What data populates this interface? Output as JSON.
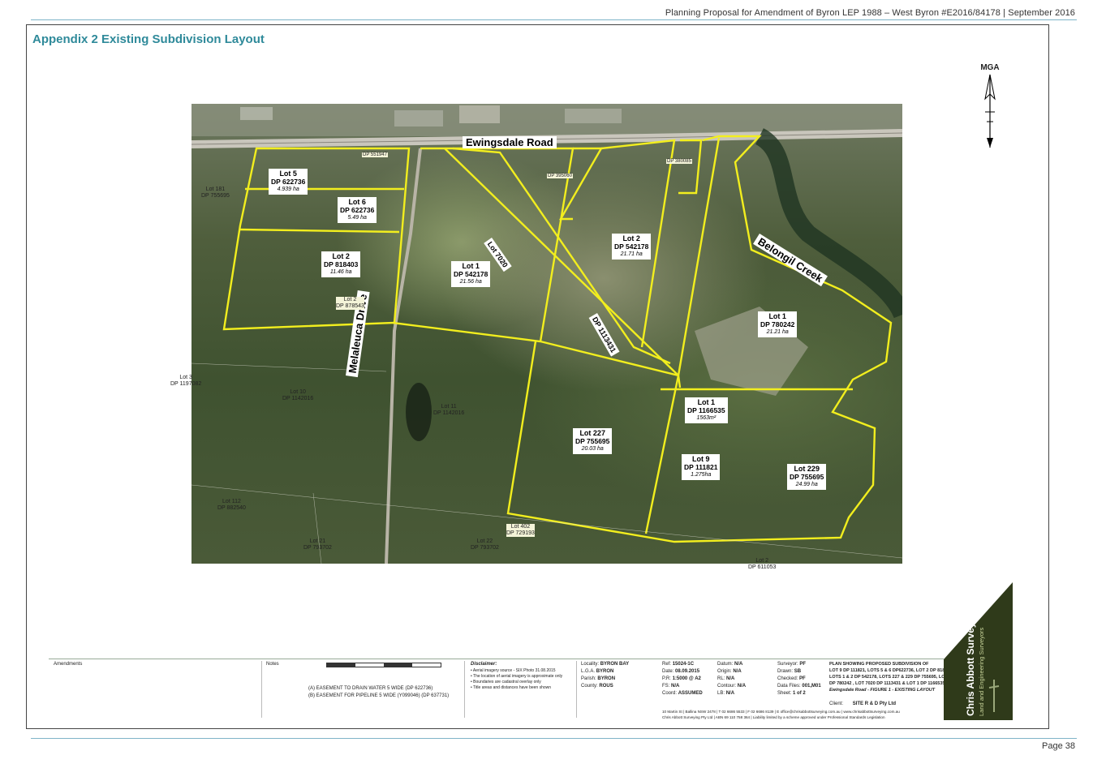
{
  "header": {
    "text": "Planning Proposal for Amendment of Byron LEP 1988 – West Byron #E2016/84178 | September  2016"
  },
  "title": "Appendix 2 Existing Subdivision Layout",
  "north": {
    "label": "MGA"
  },
  "roads": {
    "ewingsdale": "Ewingsdale Road",
    "melaleuca": "Melaleuca Drive",
    "creek": "Belongil Creek"
  },
  "lots": {
    "lot5": {
      "name": "Lot 5",
      "dp": "DP 622736",
      "area": "4.939 ha"
    },
    "lot6": {
      "name": "Lot 6",
      "dp": "DP 622736",
      "area": "5.49 ha"
    },
    "lot2_818403": {
      "name": "Lot 2",
      "dp": "DP 818403",
      "area": "11.46 ha"
    },
    "lot1_542178": {
      "name": "Lot 1",
      "dp": "DP 542178",
      "area": "21.56 ha"
    },
    "lot2_542178": {
      "name": "Lot 2",
      "dp": "DP 542178",
      "area": "21.71 ha"
    },
    "lot7020": {
      "name": "Lot 7020"
    },
    "dp1113431": {
      "name": "DP 1113431"
    },
    "lot1_780242": {
      "name": "Lot 1",
      "dp": "DP 780242",
      "area": "21.21 ha"
    },
    "lot1_1166535": {
      "name": "Lot 1",
      "dp": "DP 1166535",
      "area": "1563m²"
    },
    "lot227": {
      "name": "Lot 227",
      "dp": "DP 755695",
      "area": "20.03 ha"
    },
    "lot9": {
      "name": "Lot 9",
      "dp": "DP 111821",
      "area": "1.275ha"
    },
    "lot229": {
      "name": "Lot 229",
      "dp": "DP 755695",
      "area": "24.99 ha"
    }
  },
  "external_lots": [
    {
      "name": "Lot 181",
      "dp": "DP 755695"
    },
    {
      "name": "Lot 3",
      "dp": "DP 1197082"
    },
    {
      "name": "Lot 10",
      "dp": "DP 1142016"
    },
    {
      "name": "Lot 11",
      "dp": "DP 1142016"
    },
    {
      "name": "Lot 2",
      "dp": "DP 878543"
    },
    {
      "name": "Lot 112",
      "dp": "DP 882540"
    },
    {
      "name": "Lot 21",
      "dp": "DP 793702"
    },
    {
      "name": "Lot 22",
      "dp": "DP 793702"
    },
    {
      "name": "Lot 402",
      "dp": "DP 729193"
    },
    {
      "name": "Lot 2",
      "dp": "DP 611053"
    },
    {
      "name": "DP 551947",
      "dp": ""
    },
    {
      "name": "DP 395060",
      "dp": ""
    },
    {
      "name": "DP 380085",
      "dp": ""
    }
  ],
  "title_block": {
    "amendments": "Amendments",
    "notes": "Notes",
    "note_a": "(A)   EASEMENT TO DRAIN WATER 5 WIDE (DP 622736)",
    "note_b": "(B)   EASEMENT FOR PIPELINE 5 WIDE (Y099046) (DP 637731)",
    "disclaimer_title": "Disclaimer:",
    "disclaimer": [
      "• Aerial imagery source - SIX Photo 31.08.2015",
      "• The location of aerial imagery is approximate only",
      "• Boundaries are cadastral overlay only",
      "• Title areas and distances have been shown"
    ],
    "locality": [
      {
        "k": "Locality:",
        "v": "BYRON BAY"
      },
      {
        "k": "L.G.A.",
        "v": "BYRON"
      },
      {
        "k": "Parish:",
        "v": "BYRON"
      },
      {
        "k": "County:",
        "v": "ROUS"
      }
    ],
    "refs": [
      {
        "k": "Ref:",
        "v": "15024-1C"
      },
      {
        "k": "Date:",
        "v": "08.09.2015"
      },
      {
        "k": "P.R:",
        "v": "1:5000 @ A2"
      },
      {
        "k": "FS:",
        "v": "N/A"
      },
      {
        "k": "Coord:",
        "v": "ASSUMED"
      }
    ],
    "datum": [
      {
        "k": "Datum:",
        "v": "N/A"
      },
      {
        "k": "Origin:",
        "v": "N/A"
      },
      {
        "k": "RL:",
        "v": "N/A"
      },
      {
        "k": "Contour:",
        "v": "N/A"
      },
      {
        "k": "LB:",
        "v": "N/A"
      }
    ],
    "survey": [
      {
        "k": "Surveyor:",
        "v": "PF"
      },
      {
        "k": "Drawn:",
        "v": "SB"
      },
      {
        "k": "Checked:",
        "v": "PF"
      },
      {
        "k": "Data Files:",
        "v": "001,M01"
      },
      {
        "k": "Sheet:",
        "v": "1 of 2"
      }
    ],
    "plan_title": [
      "PLAN SHOWING PROPOSED SUBDIVISION OF",
      "LOT 9 DP 111821, LOTS 5 & 6 DP622736, LOT 2 DP 818403,",
      "LOTS 1 & 2 DP 542178, LOTS 227 & 229 DP 755695, LOT 1",
      "DP 780242 , LOT 7020 DP 1113431 & LOT 1 DP 1166535",
      "Ewingsdale Road - FIGURE 1 - EXISTING LAYOUT"
    ],
    "client_label": "Client:",
    "client": "SITE R & D Pty Ltd",
    "address": "10 Martin St | Ballina NSW 2478 | T 02 6686 5533 | F 02 6686 8139 | E office@chrisabbottsurveying.com.au | www.chrisabbottsurveying.com.au",
    "liability": "Chris Abbott Surveying Pty Ltd | ABN 69 110 758 364 | Liability limited by a scheme approved under Professional Standards Legislation"
  },
  "logo": {
    "name": "Chris Abbott Surveying",
    "sub": "Land and Engineering Surveyors"
  },
  "colors": {
    "boundary": "#f2ee1e",
    "accent": "#2f8a9a",
    "logo_bg": "#2f3a1a"
  },
  "page": {
    "number": "Page 38"
  }
}
